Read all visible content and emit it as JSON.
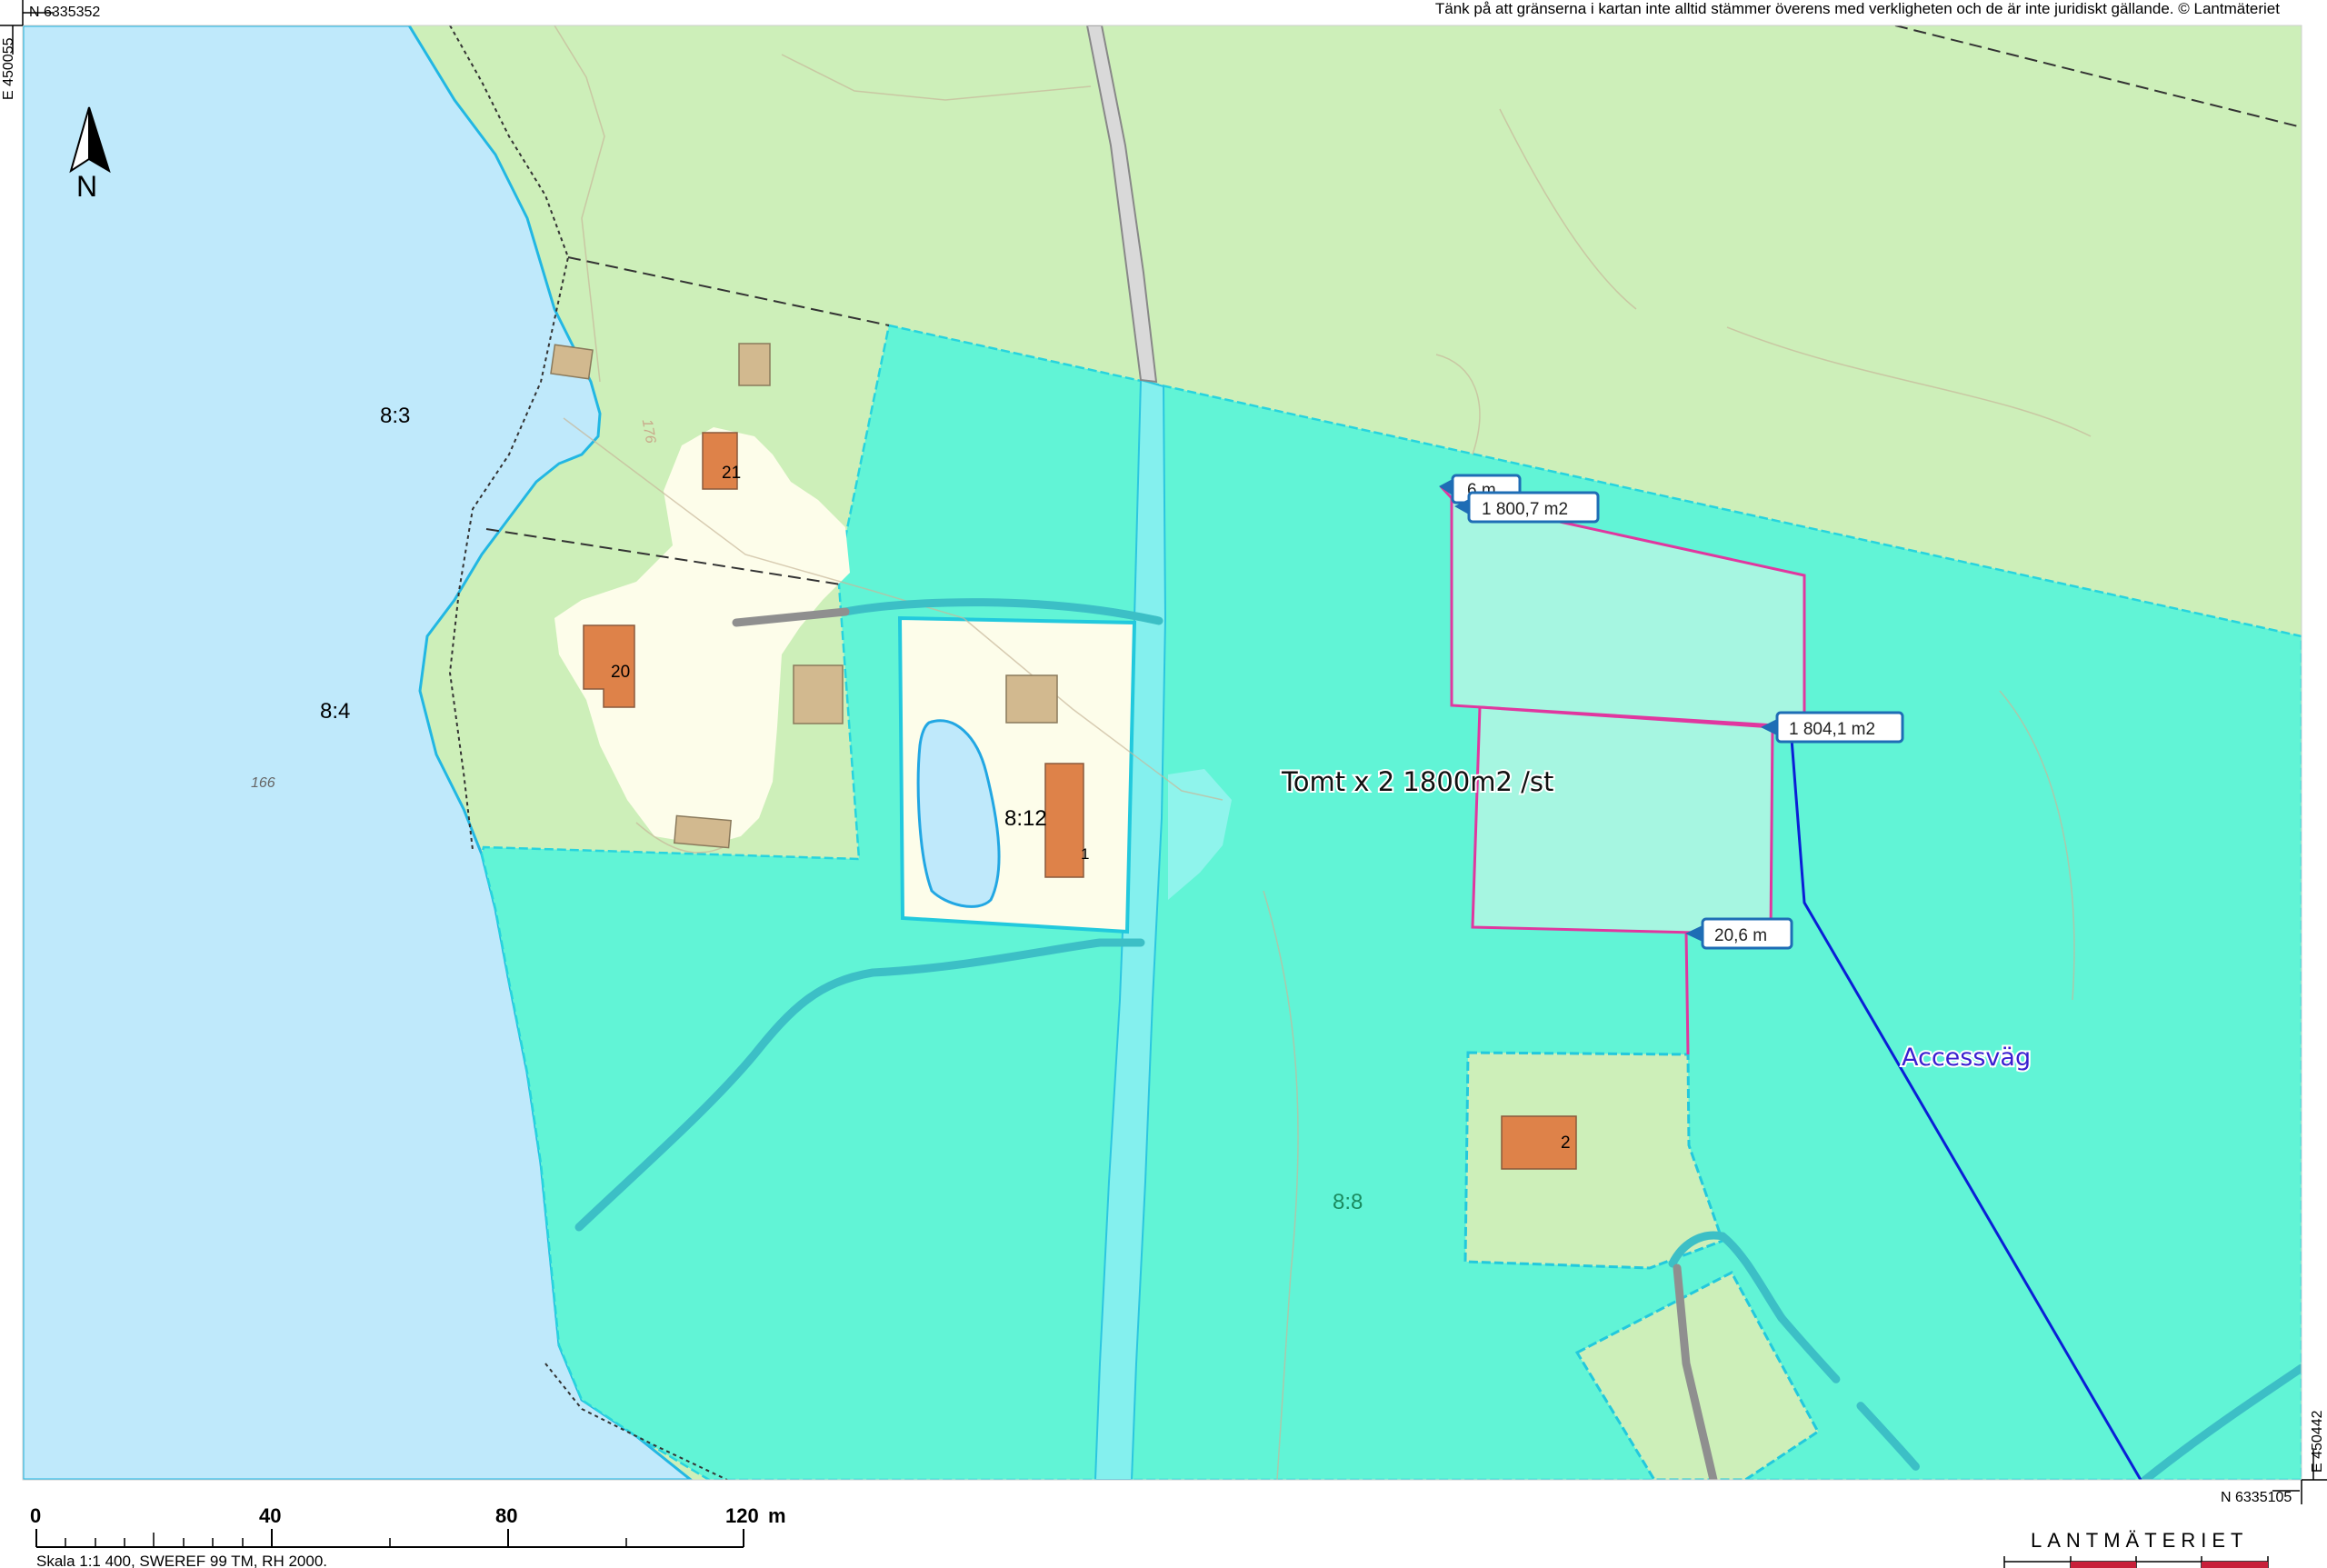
{
  "header": {
    "coord_top_left_n": "N 6335352",
    "coord_top_left_e": "E 450055",
    "disclaimer": "Tänk på att gränserna i kartan inte alltid stämmer överens med verkligheten och de är inte juridiskt gällande. © Lantmäteriet"
  },
  "footer": {
    "coord_bottom_right_n": "N 6335105",
    "coord_bottom_right_e": "E 450442",
    "scale_ticks": [
      "0",
      "40",
      "80",
      "120"
    ],
    "scale_unit": "m",
    "scale_caption": "Skala 1:1 400, SWEREF 99 TM, RH 2000.",
    "logo_text": "LANTMÄTERIET"
  },
  "north_arrow": {
    "letter": "N"
  },
  "parcels": {
    "p83": "8:3",
    "p84": "8:4",
    "p812": "8:12",
    "p88": "8:8"
  },
  "elevations": {
    "e166": "166",
    "e176": "176"
  },
  "buildings": {
    "b21": "21",
    "b20": "20",
    "b1": "1",
    "b2": "2"
  },
  "measurements": {
    "m6": "6 m",
    "area1": "1 800,7 m2",
    "area2": "1 804,1 m2",
    "m20": "20,6 m"
  },
  "annotations": {
    "plots": "Tomt x 2 1800m2 /st",
    "access_road": "Accessväg"
  },
  "colors": {
    "water": "#bfe9fb",
    "land": "#cdefb9",
    "selected_area": "#61f4d6",
    "plot_fill": "#a6f6e1",
    "yard": "#fdfdea",
    "building_res": "#de8249",
    "building_other": "#d2b98f",
    "boundary_pink": "#e0379f",
    "access_line": "#0a1fd6"
  }
}
